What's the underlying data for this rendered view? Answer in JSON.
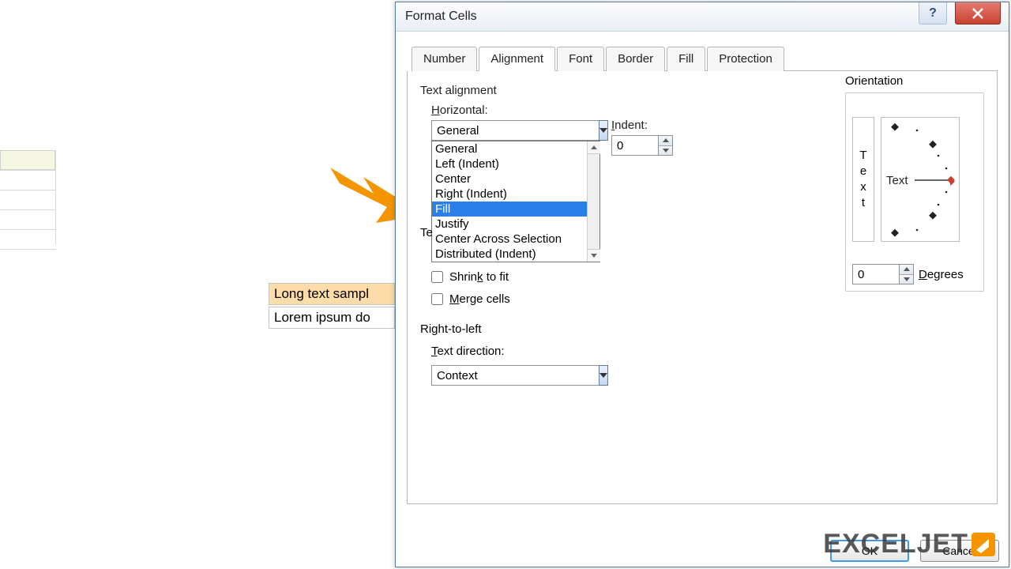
{
  "dialog": {
    "title": "Format Cells",
    "tabs": [
      "Number",
      "Alignment",
      "Font",
      "Border",
      "Fill",
      "Protection"
    ],
    "active_tab_index": 1,
    "sections": {
      "text_alignment": "Text alignment",
      "orientation": "Orientation",
      "text_control": "Text control",
      "right_to_left": "Right-to-left"
    },
    "horizontal": {
      "label": "Horizontal:",
      "value": "General",
      "options": [
        "General",
        "Left (Indent)",
        "Center",
        "Right (Indent)",
        "Fill",
        "Justify",
        "Center Across Selection",
        "Distributed (Indent)"
      ],
      "highlighted_index": 4
    },
    "indent": {
      "label": "Indent:",
      "value": "0"
    },
    "shrink": {
      "label": "Shrink to fit",
      "checked": false
    },
    "merge": {
      "label": "Merge cells",
      "checked": false
    },
    "text_direction": {
      "label": "Text direction:",
      "value": "Context"
    },
    "orientation_widget": {
      "vertical_text": [
        "T",
        "e",
        "x",
        "t"
      ],
      "horizontal_text": "Text",
      "degrees_label": "Degrees",
      "degrees_value": "0"
    },
    "buttons": {
      "ok": "OK",
      "cancel": "Cancel"
    }
  },
  "sheet": {
    "row1": "Long text sampl",
    "row2": "Lorem ipsum do"
  },
  "watermark": {
    "text": "EXCELJET"
  },
  "colors": {
    "highlight": "#2a80e8",
    "arrow": "#f49500"
  }
}
